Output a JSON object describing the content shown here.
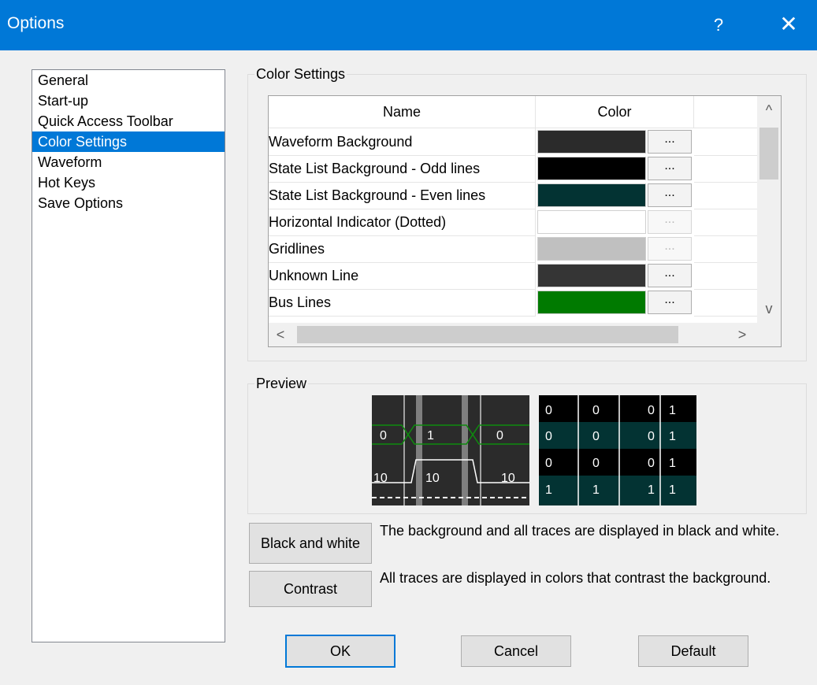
{
  "window": {
    "title": "Options",
    "help": "?",
    "close": "✕"
  },
  "nav": {
    "items": [
      "General",
      "Start-up",
      "Quick Access Toolbar",
      "Color Settings",
      "Waveform",
      "Hot Keys",
      "Save Options"
    ],
    "selected_index": 3
  },
  "color_settings": {
    "legend": "Color Settings",
    "columns": {
      "name": "Name",
      "color": "Color"
    },
    "rows": [
      {
        "name": "Waveform Background",
        "color": "#2b2b2b",
        "button": "...",
        "enabled": true
      },
      {
        "name": "State List Background - Odd lines",
        "color": "#000000",
        "button": "...",
        "enabled": true
      },
      {
        "name": "State List Background - Even lines",
        "color": "#033333",
        "button": "...",
        "enabled": true
      },
      {
        "name": "Horizontal Indicator (Dotted)",
        "color": "#ffffff",
        "button": "...",
        "enabled": false
      },
      {
        "name": "Gridlines",
        "color": "#c0c0c0",
        "button": "...",
        "enabled": false
      },
      {
        "name": "Unknown Line",
        "color": "#353535",
        "button": "...",
        "enabled": true
      },
      {
        "name": "Bus Lines",
        "color": "#007a00",
        "button": "...",
        "enabled": true
      }
    ],
    "scroll": {
      "up": "^",
      "down": "v",
      "left": "<",
      "right": ">"
    }
  },
  "preview": {
    "legend": "Preview",
    "waveform": {
      "bus_values": [
        "0",
        "1",
        "0"
      ],
      "lower_values": [
        "10",
        "10",
        "10"
      ]
    },
    "state_list": {
      "rows": [
        [
          "0",
          "0",
          "0",
          "1"
        ],
        [
          "0",
          "0",
          "0",
          "1"
        ],
        [
          "0",
          "0",
          "0",
          "1"
        ],
        [
          "1",
          "1",
          "1",
          "1"
        ]
      ]
    }
  },
  "options": [
    {
      "button": "Black and white",
      "description": "The background and all traces are displayed in black and white."
    },
    {
      "button": "Contrast",
      "description": "All traces are displayed in colors that contrast the background."
    }
  ],
  "footer": {
    "ok": "OK",
    "cancel": "Cancel",
    "default": "Default"
  }
}
